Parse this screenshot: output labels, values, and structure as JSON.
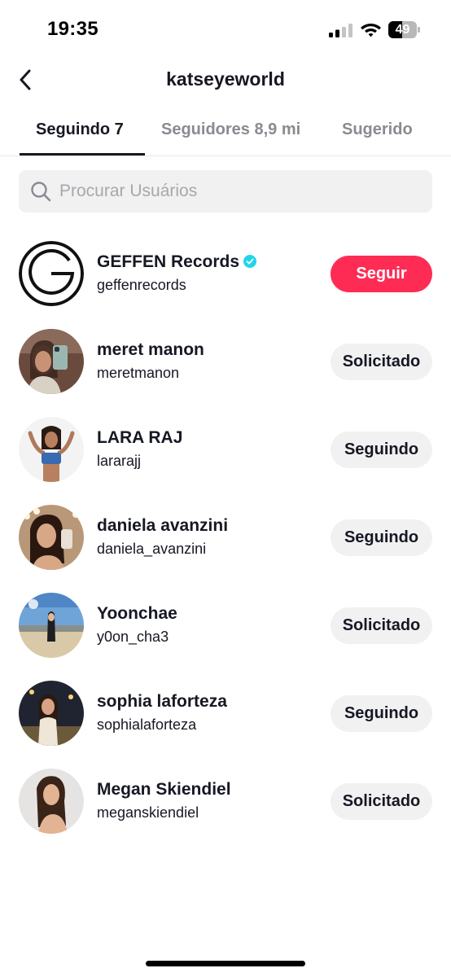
{
  "status_bar": {
    "time": "19:35",
    "battery": "49",
    "battery_level": 0.49
  },
  "header": {
    "title": "katseyeworld",
    "back_icon": "chevron-left-icon"
  },
  "tabs": [
    {
      "label": "Seguindo 7",
      "active": true
    },
    {
      "label": "Seguidores 8,9 mi",
      "active": false
    },
    {
      "label": "Sugerido",
      "active": false
    }
  ],
  "search": {
    "placeholder": "Procurar Usuários",
    "value": ""
  },
  "users": [
    {
      "name": "GEFFEN Records",
      "handle": "geffenrecords",
      "verified": true,
      "button": "Seguir",
      "button_style": "primary"
    },
    {
      "name": "meret manon",
      "handle": "meretmanon",
      "verified": false,
      "button": "Solicitado",
      "button_style": "secondary"
    },
    {
      "name": "LARA RAJ",
      "handle": "lararajj",
      "verified": false,
      "button": "Seguindo",
      "button_style": "secondary"
    },
    {
      "name": "daniela avanzini",
      "handle": "daniela_avanzini",
      "verified": false,
      "button": "Seguindo",
      "button_style": "secondary"
    },
    {
      "name": "Yoonchae",
      "handle": "y0on_cha3",
      "verified": false,
      "button": "Solicitado",
      "button_style": "secondary"
    },
    {
      "name": "sophia laforteza",
      "handle": "sophialaforteza",
      "verified": false,
      "button": "Seguindo",
      "button_style": "secondary"
    },
    {
      "name": "Megan Skiendiel",
      "handle": "meganskiendiel",
      "verified": false,
      "button": "Solicitado",
      "button_style": "secondary"
    }
  ],
  "colors": {
    "primary_button": "#fe2c55",
    "secondary_button": "#f1f1f2",
    "verified_badge": "#20d5ec",
    "text": "#161823",
    "muted_text": "#8a8b91"
  }
}
